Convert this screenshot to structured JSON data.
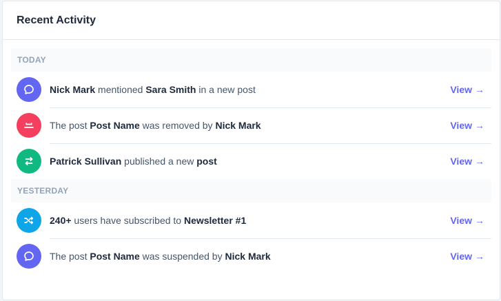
{
  "card": {
    "title": "Recent Activity"
  },
  "groups": [
    {
      "label": "TODAY",
      "items": [
        {
          "icon": "chat-bubble-icon",
          "color": "#6366f1",
          "segments": [
            {
              "text": "Nick Mark",
              "strong": true
            },
            {
              "text": " mentioned ",
              "strong": false
            },
            {
              "text": "Sara Smith",
              "strong": true
            },
            {
              "text": " in a new post",
              "strong": false
            }
          ],
          "link": "View",
          "arrow": "→"
        },
        {
          "icon": "tray-icon",
          "color": "#f43f5e",
          "segments": [
            {
              "text": "The post ",
              "strong": false
            },
            {
              "text": "Post Name",
              "strong": true
            },
            {
              "text": " was removed by ",
              "strong": false
            },
            {
              "text": "Nick Mark",
              "strong": true
            }
          ],
          "link": "View",
          "arrow": "→"
        },
        {
          "icon": "swap-arrows-icon",
          "color": "#10b981",
          "segments": [
            {
              "text": "Patrick Sullivan",
              "strong": true
            },
            {
              "text": " published a new ",
              "strong": false
            },
            {
              "text": "post",
              "strong": true
            }
          ],
          "link": "View",
          "arrow": "→"
        }
      ]
    },
    {
      "label": "YESTERDAY",
      "items": [
        {
          "icon": "shuffle-icon",
          "color": "#0ea5e9",
          "segments": [
            {
              "text": "240+",
              "strong": true
            },
            {
              "text": " users have subscribed to ",
              "strong": false
            },
            {
              "text": "Newsletter #1",
              "strong": true
            }
          ],
          "link": "View",
          "arrow": "→"
        },
        {
          "icon": "chat-bubble-icon",
          "color": "#6366f1",
          "segments": [
            {
              "text": "The post ",
              "strong": false
            },
            {
              "text": "Post Name",
              "strong": true
            },
            {
              "text": " was suspended by ",
              "strong": false
            },
            {
              "text": "Nick Mark",
              "strong": true
            }
          ],
          "link": "View",
          "arrow": "→"
        }
      ]
    }
  ]
}
